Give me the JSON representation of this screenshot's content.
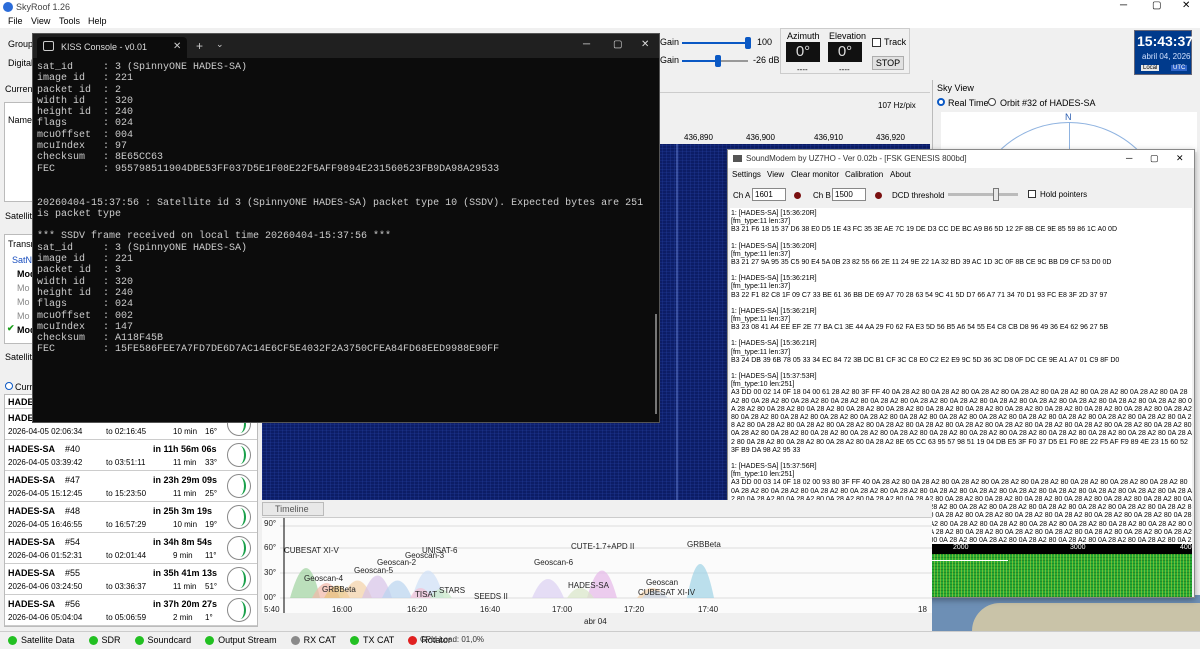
{
  "app": {
    "title": "SkyRoof 1.26",
    "menu": [
      "File",
      "View",
      "Tools",
      "Help"
    ]
  },
  "left": {
    "group_label": "Group",
    "digital_label": "Digital",
    "current_label": "Curren",
    "name_header": "Name",
    "satellite_label": "Satellite",
    "transmit_label": "Transm",
    "satnog_label": "SatNO",
    "mode_items": [
      "Mod",
      "Mo",
      "Mo",
      "Mo",
      "Mod"
    ],
    "sat_passes_label": "Satellite",
    "current_radio": "Curr",
    "first_row": "HADES-SA"
  },
  "passes": [
    {
      "sat": "HADES-SA",
      "num": "#39",
      "countdown": "in 10h 22m 57s",
      "start": "2026-04-05  02:06:34",
      "end": "02:16:45",
      "dur": "10 min",
      "el": "16°"
    },
    {
      "sat": "HADES-SA",
      "num": "#40",
      "countdown": "in 11h 56m 06s",
      "start": "2026-04-05  03:39:42",
      "end": "03:51:11",
      "dur": "11 min",
      "el": "33°"
    },
    {
      "sat": "HADES-SA",
      "num": "#47",
      "countdown": "in 23h 29m 09s",
      "start": "2026-04-05  15:12:45",
      "end": "15:23:50",
      "dur": "11 min",
      "el": "25°"
    },
    {
      "sat": "HADES-SA",
      "num": "#48",
      "countdown": "in 25h 3m 19s",
      "start": "2026-04-05  16:46:55",
      "end": "16:57:29",
      "dur": "10 min",
      "el": "19°"
    },
    {
      "sat": "HADES-SA",
      "num": "#54",
      "countdown": "in 34h 8m 54s",
      "start": "2026-04-06  01:52:31",
      "end": "02:01:44",
      "dur": "9 min",
      "el": "11°"
    },
    {
      "sat": "HADES-SA",
      "num": "#55",
      "countdown": "in 35h 41m 13s",
      "start": "2026-04-06  03:24:50",
      "end": "03:36:37",
      "dur": "11 min",
      "el": "51°"
    },
    {
      "sat": "HADES-SA",
      "num": "#56",
      "countdown": "in 37h 20m 27s",
      "start": "2026-04-06  05:04:04",
      "end": "05:06:59",
      "dur": "2 min",
      "el": "1°"
    }
  ],
  "top": {
    "gain1_label": "Gain",
    "gain1_value": "100",
    "gain1_level": 1.0,
    "gain2_label": "Gain",
    "gain2_value": "-26 dB",
    "gain2_level": 0.55,
    "azimuth_label": "Azimuth",
    "azimuth_value": "0°",
    "azimuth_sub": "----",
    "elevation_label": "Elevation",
    "elevation_value": "0°",
    "elevation_sub": "----",
    "track_label": "Track",
    "stop_label": "STOP",
    "clock_time": "15:43:37",
    "clock_date": "abril 04, 2026",
    "clock_local": "Local",
    "clock_utc": "UTC"
  },
  "freq": {
    "rate": "107 Hz/pix",
    "ticks": [
      "436,890",
      "436,900",
      "436,910",
      "436,920"
    ]
  },
  "sky": {
    "title": "Sky View",
    "realtime_label": "Real Time",
    "orbit_label": "Orbit #32 of HADES-SA",
    "north": "N"
  },
  "console": {
    "title": "KISS Console - v0.01",
    "lines": [
      "sat_id     : 3 (SpinnyONE HADES-SA)",
      "image id   : 221",
      "packet id  : 2",
      "width id   : 320",
      "height id  : 240",
      "flags      : 024",
      "mcuOffset  : 004",
      "mcuIndex   : 97",
      "checksum   : 8E65CC63",
      "FEC        : 955798511904DBE53FF037D5E1F08E22F5AFF9894E231560523FB9DA98A29533",
      "",
      "",
      "20260404-15:37:56 : Satellite id 3 (SpinnyONE HADES-SA) packet type 10 (SSDV). Expected bytes are 251 for th",
      "is packet type",
      "",
      "*** SSDV frame received on local time 20260404-15:37:56 ***",
      "sat_id     : 3 (SpinnyONE HADES-SA)",
      "image id   : 221",
      "packet id  : 3",
      "width id   : 320",
      "height id  : 240",
      "flags      : 024",
      "mcuOffset  : 002",
      "mcuIndex   : 147",
      "checksum   : A118F45B",
      "FEC        : 15FE586FEE7A7FD7DE6D7AC14E6CF5E4032F2A3750CFEA84FD68EED9988E90FF"
    ]
  },
  "soundmodem": {
    "title": "SoundModem by UZ7HO - Ver 0.02b - [FSK GENESIS 800bd]",
    "menu": [
      "Settings",
      "View",
      "Clear monitor",
      "Calibration",
      "About"
    ],
    "cha_label": "Ch A",
    "cha_value": "1601",
    "chb_label": "Ch B",
    "chb_value": "1500",
    "dcd_label": "DCD threshold",
    "hold_label": "Hold pointers",
    "monitor": [
      [
        "1: [HADES-SA] [15:36:20R]",
        "[fm_type:11 len:37]",
        "B3 21 F6 18 15 37 D6 38 E0 D5 1E 43 FC 35 3E AE 7C 19 DE D3 CC DE BC A9 B6 5D 12 2F 8B CE 9E 85 59 86 1C A0 0D"
      ],
      [
        "1: [HADES-SA] [15:36:20R]",
        "[fm_type:11 len:37]",
        "B3 21 27 9A 95 35 C5 90 E4 5A 0B 23 82 55 66 2E 11 24 9E 22 1A 32 BD 39 AC 1D 3C 0F 8B CE 9C BB D9 CF 53 D0 0D"
      ],
      [
        "1: [HADES-SA] [15:36:21R]",
        "[fm_type:11 len:37]",
        "B3 22 F1 82 C8 1F 09 C7 33 BE 61 36 BB DE 69 A7 70 28 63 54 9C 41 5D D7 66 A7 71 34 70 D1 93 FC E8 3F 2D 37 97"
      ],
      [
        "1: [HADES-SA] [15:36:21R]",
        "[fm_type:11 len:37]",
        "B3 23 08 41 A4 EE EF 2E 77 BA C1 3E 44 AA 29 F0 62 FA E3 5D 56 B5 A6 54 55 E4 C8 CB D8 96 49 36 E4 62 96 27 5B"
      ],
      [
        "1: [HADES-SA] [15:36:21R]",
        "[fm_type:11 len:37]",
        "B3 24 DB 39 6B 78 05 33 34 EC 84 72 3B DC B1 CF 3C C8 E0 C2 E2 E9 9C 5D 36 3C D8 0F DC CE 9E A1 A7 01 C9 8F D0"
      ],
      [
        "1: [HADES-SA] [15:37:53R]",
        "[fm_type:10 len:251]",
        "A3 DD 00 02 14 0F 18 04 00 61 28 A2 80 3F FF 40 0A 28 A2 80 0A 28 A2 80 0A 28 A2 80 0A 28 A2 80 0A 28 A2 80 0A 28 A2 80 0A 28 A2 80 0A 28 A2 80 0A 28 A2 80 0A 28 A2 80 0A 28 A2 80 0A 28 A2 80 0A 28 A2 80 0A 28 A2 80 0A 28 A2 80 0A 28 A2 80 0A 28 A2 80 0A 28 A2 80 0A 28 A2 80 0A 28 A2 80 0A 28 A2 80 0A 28 A2 80 0A 28 A2 80 0A 28 A2 80 0A 28 A2 80 0A 28 A2 80 0A 28 A2 80 0A 28 A2 80 0A 28 A2 80 0A 28 A2 80 0A 28 A2 80 0A 28 A2 80 0A 28 A2 80 0A 28 A2 80 0A 28 A2 80 0A 28 A2 80 0A 28 A2 80 0A 28 A2 80 0A 28 A2 80 0A 28 A2 80 0A 28 A2 80 0A 28 A2 80 0A 28 A2 80 0A 28 A2 80 0A 28 A2 80 0A 28 A2 80 0A 28 A2 80 0A 28 A2 80 0A 28 A2 80 0A 28 A2 80 0A 28 A2 80 0A 28 A2 80 0A 28 A2 80 0A 28 A2 80 0A 28 A2 80 0A 28 A2 80 0A 28 A2 80 0A 28 A2 80 0A 28 A2 80 0A 28 A2 80 0A 28 A2 80 0A 28 A2 80 0A 28 A2 80 0A 28 A2 80 0A 28 A2 80 0A 28 A2 80 0A 28 A2 80 0A 28 A2 80 0A 28 A2 80 0A 28 A2 8E 65 CC 63 95 57 98 51 19 04 DB E5 3F F0 37 D5 E1 F0 8E 22 F5 AF F9 89 4E 23 15 60 52 3F B9 DA 98 A2 95 33"
      ],
      [
        "1: [HADES-SA] [15:37:56R]",
        "[fm_type:10 len:251]",
        "A3 DD 00 03 14 0F 18 02 00 93 80 3F FF 40 0A 28 A2 80 0A 28 A2 80 0A 28 A2 80 0A 28 A2 80 0A 28 A2 80 0A 28 A2 80 0A 28 A2 80 0A 28 A2 80 0A 28 A2 80 0A 28 A2 80 0A 28 A2 80 0A 28 A2 80 0A 28 A2 80 0A 28 A2 80 0A 28 A2 80 0A 28 A2 80 0A 28 A2 80 0A 28 A2 80 0A 28 A2 80 0A 28 A2 80 0A 28 A2 80 0A 28 A2 80 0A 28 A2 80 0A 28 A2 80 0A 28 A2 80 0A 28 A2 80 0A 28 A2 80 0A 28 A2 80 0A 28 A2 80 0A 28 A2 80 0A 28 A2 80 0A 28 A2 80 0A 28 A2 80 0A 28 A2 80 0A 28 A2 80 0A 28 A2 80 0A 28 A2 80 0A 28 A2 80 0A 28 A2 80 0A 28 A2 80 0A 28 A2 80 0A 28 A2 80 0A 28 A2 80 0A 28 A2 80 0A 28 A2 80 0A 28 A2 80 0A 28 A2 80 0A 28 A2 80 0A 28 A2 80 0A 28 A2 80 0A 28 A2 80 0A 28 A2 80 0A 28 A2 80 0A 28 A2 80 0A 28 A2 80 0A 28 A2 80 0A 28 A2 80 0A 28 A2 80 0A 28 A2 80 0A 28 A2 80 0A 28 A2 80 0A 28 A2 80 0A 28 A2 80 0A 28 A2 80 0A 28 A2 80 0A 28 A2 80 0A 28 A2 80 0A 28 A2 80 0A 28 A2 80 0A 28 A2 80 0A 28 A2 80 0A 28 A2 80 0A 28 A2 80 0A 28 A2 80 0A 28 A2 80 0A 28 A2 80 0A 28 A2 80 0A 28 A2 80 0A 28 A2 80 0A 28 A2 80 0A 28 A2 80 0A 28 A2 80 0A 28 A2 80 0A 28 A2 80 0A 28 A2 80 0A 28 A2 80 0A 28 A2 80 0A 28 A2 80 0A 28 A2 80 0A 28 A2 80 0A 28 A2 80 0A 28 A2 80 0A 28 A2 80 0A 28 A2 80 0A 28 A2 80 0A 28 A2 80 0A 28 A2 80 0A 28 A2 80 0A 28 A2 80 0A 28 A2 80 0A 28 A2 80 0A 28 A2 80 0A 28 A2 80 0A 28 A2 80 0A 28 A2 80 0A 28 A2 80 0A 28 A2 80 0A 28 A2 80 0A 28 A2 80 0A 28 A2 80 0A 28 A2 80 0A 28 A2 80 0A 28 A2 80 0A 28 A2 80 0A 28 A2 80 0A 28 A2 80 0A 28 A2 80 0A 28 A2 80 0A 28 A2 80 0A 28 A2 80 0A 28 A2 80 0A 28 A2 80 0A 28 A2 80 0A 28 A2 80 0A 28 A2 80 0A 28 A2 80 0A 28 A2 80 0A 28 A2 80 0A 28 A2 80 0A 28 A2 80 0A 28 A2 80 0A 28 A2 80 0A 28 A2 80 0A 28 A2 80 0A A1 18 F4 5B 15 FE 58 6F EE 7A 7F D7 DE 6D 7A C1 4E 6C F5 E4 03 2F 2A 37 50 CF EA 84 FD 68 EE D9 98 8E 90 FF"
      ]
    ],
    "scale": [
      "1000",
      "2000",
      "3000",
      "400"
    ]
  },
  "timeline": {
    "tab": "Timeline",
    "elev_ticks": [
      "90°",
      "60°",
      "30°",
      "00°"
    ],
    "time_ticks": [
      "5:40",
      "16:00",
      "16:20",
      "16:40",
      "17:00",
      "17:20",
      "17:40",
      "18"
    ],
    "date_label": "abr 04",
    "sats": [
      "CUBESAT XI-V",
      "Geoscan-4",
      "GRBBeta",
      "Geoscan-5",
      "Geoscan-2",
      "Geoscan-3",
      "UNISAT-6",
      "TISAT",
      "STARS",
      "SEEDS II",
      "Geoscan-6",
      "CUTE-1.7+APD II",
      "HADES-SA",
      "Geoscan",
      "CUBESAT XI-IV",
      "GRBBeta"
    ]
  },
  "status": {
    "items": [
      {
        "label": "Satellite Data",
        "color": "#22c022"
      },
      {
        "label": "SDR",
        "color": "#22c022"
      },
      {
        "label": "Soundcard",
        "color": "#22c022"
      },
      {
        "label": "Output Stream",
        "color": "#22c022"
      },
      {
        "label": "RX CAT",
        "color": "#8a8a8a"
      },
      {
        "label": "TX CAT",
        "color": "#22c022"
      },
      {
        "label": "Rotator",
        "color": "#e02020"
      }
    ],
    "cpu": "CPU Load: 01,0%"
  },
  "colors": {
    "accent": "#0a246a",
    "waterfall": "#0c1d66",
    "console_bg": "#0c0c0c",
    "clock_bg": "#003a8c"
  }
}
